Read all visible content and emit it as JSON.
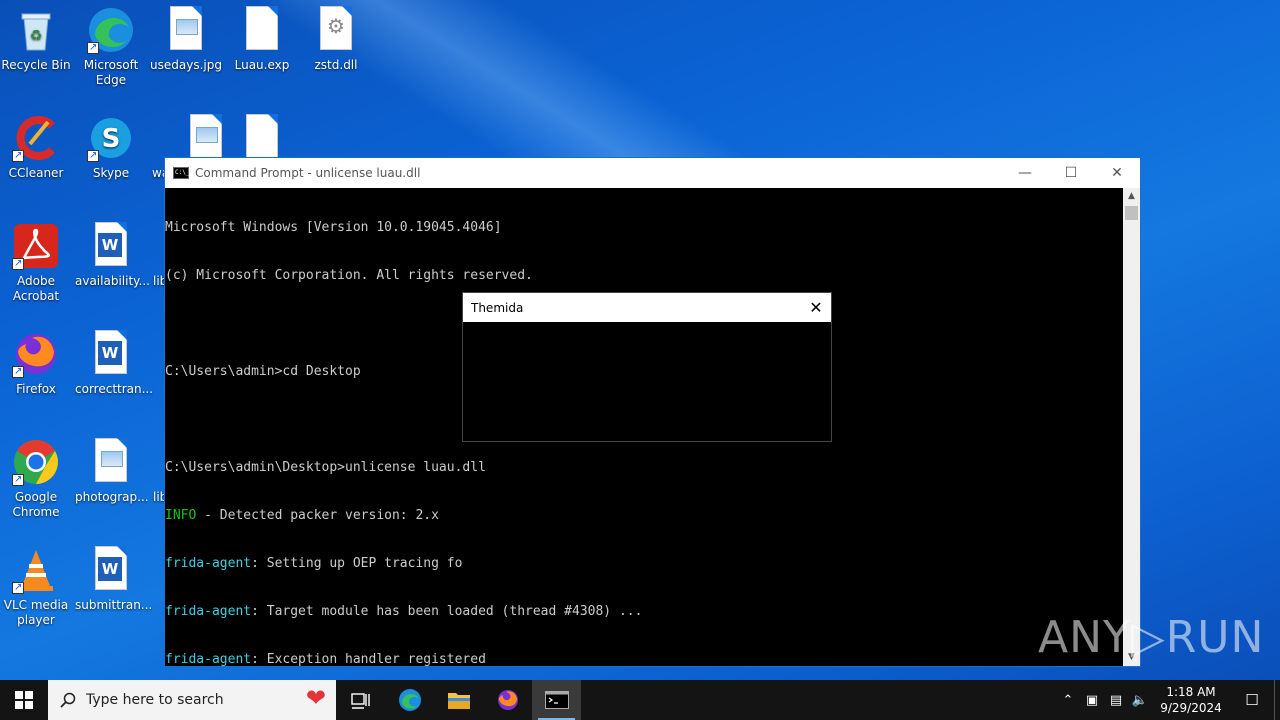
{
  "desktop": {
    "icons": [
      {
        "label": "Recycle Bin"
      },
      {
        "label": "Microsoft Edge"
      },
      {
        "label": "usedays.jpg"
      },
      {
        "label": "Luau.exp"
      },
      {
        "label": "zstd.dll"
      },
      {
        "label": "CCleaner"
      },
      {
        "label": "Skype"
      },
      {
        "label": "Adobe Acrobat"
      },
      {
        "label": "availability..."
      },
      {
        "label": "Firefox"
      },
      {
        "label": "correcttran..."
      },
      {
        "label": "Google Chrome"
      },
      {
        "label": "photograp..."
      },
      {
        "label": "VLC media player"
      },
      {
        "label": "submittran..."
      }
    ],
    "partial_labels": {
      "wa": "wa",
      "lib1": "lib",
      "lib2": "lib"
    }
  },
  "cmd": {
    "title": "Command Prompt - unlicense  luau.dll",
    "lines": [
      {
        "prefix": "",
        "text": "Microsoft Windows [Version 10.0.19045.4046]"
      },
      {
        "prefix": "",
        "text": "(c) Microsoft Corporation. All rights reserved."
      },
      {
        "prefix": "",
        "text": ""
      },
      {
        "prefix": "",
        "text": "C:\\Users\\admin>cd Desktop"
      },
      {
        "prefix": "",
        "text": ""
      },
      {
        "prefix": "",
        "text": "C:\\Users\\admin\\Desktop>unlicense luau.dll"
      },
      {
        "prefix": "INFO",
        "text": " - Detected packer version: 2.x"
      },
      {
        "prefix": "frida-agent",
        "text": ": Setting up OEP tracing fo"
      },
      {
        "prefix": "frida-agent",
        "text": ": Target module has been loaded (thread #4308) ..."
      },
      {
        "prefix": "frida-agent",
        "text": ": Exception handler registered"
      }
    ]
  },
  "dialog": {
    "title": "Themida"
  },
  "watermark": "ANY▷RUN",
  "taskbar": {
    "search_placeholder": "Type here to search",
    "time": "1:18 AM",
    "date": "9/29/2024"
  },
  "colors": {
    "info": "#16c60c",
    "frida": "#3fd0e0",
    "desktop": "#0b63d4"
  }
}
